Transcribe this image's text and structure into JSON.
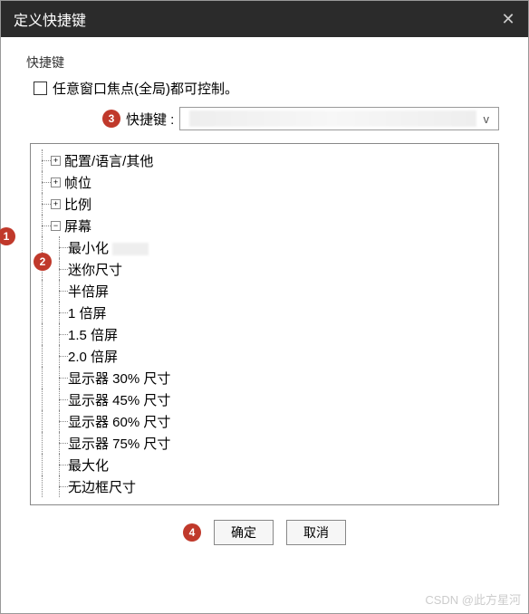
{
  "window": {
    "title": "定义快捷键"
  },
  "group": {
    "label": "快捷键",
    "checkbox_label": "任意窗口焦点(全局)都可控制。",
    "shortcut_label": "快捷键 :"
  },
  "tree": {
    "top_nodes": [
      {
        "label": "配置/语言/其他",
        "expanded": false
      },
      {
        "label": "帧位",
        "expanded": false
      },
      {
        "label": "比例",
        "expanded": false
      }
    ],
    "screen_node": {
      "label": "屏幕",
      "expanded": true,
      "children": [
        "最小化",
        "迷你尺寸",
        "半倍屏",
        "1 倍屏",
        "1.5 倍屏",
        "2.0 倍屏",
        "显示器 30% 尺寸",
        "显示器 45% 尺寸",
        "显示器 60% 尺寸",
        "显示器 75% 尺寸",
        "最大化",
        "无边框尺寸"
      ]
    }
  },
  "buttons": {
    "ok": "确定",
    "cancel": "取消"
  },
  "callouts": {
    "c1": "1",
    "c2": "2",
    "c3": "3",
    "c4": "4"
  },
  "watermark": "CSDN @此方星河"
}
